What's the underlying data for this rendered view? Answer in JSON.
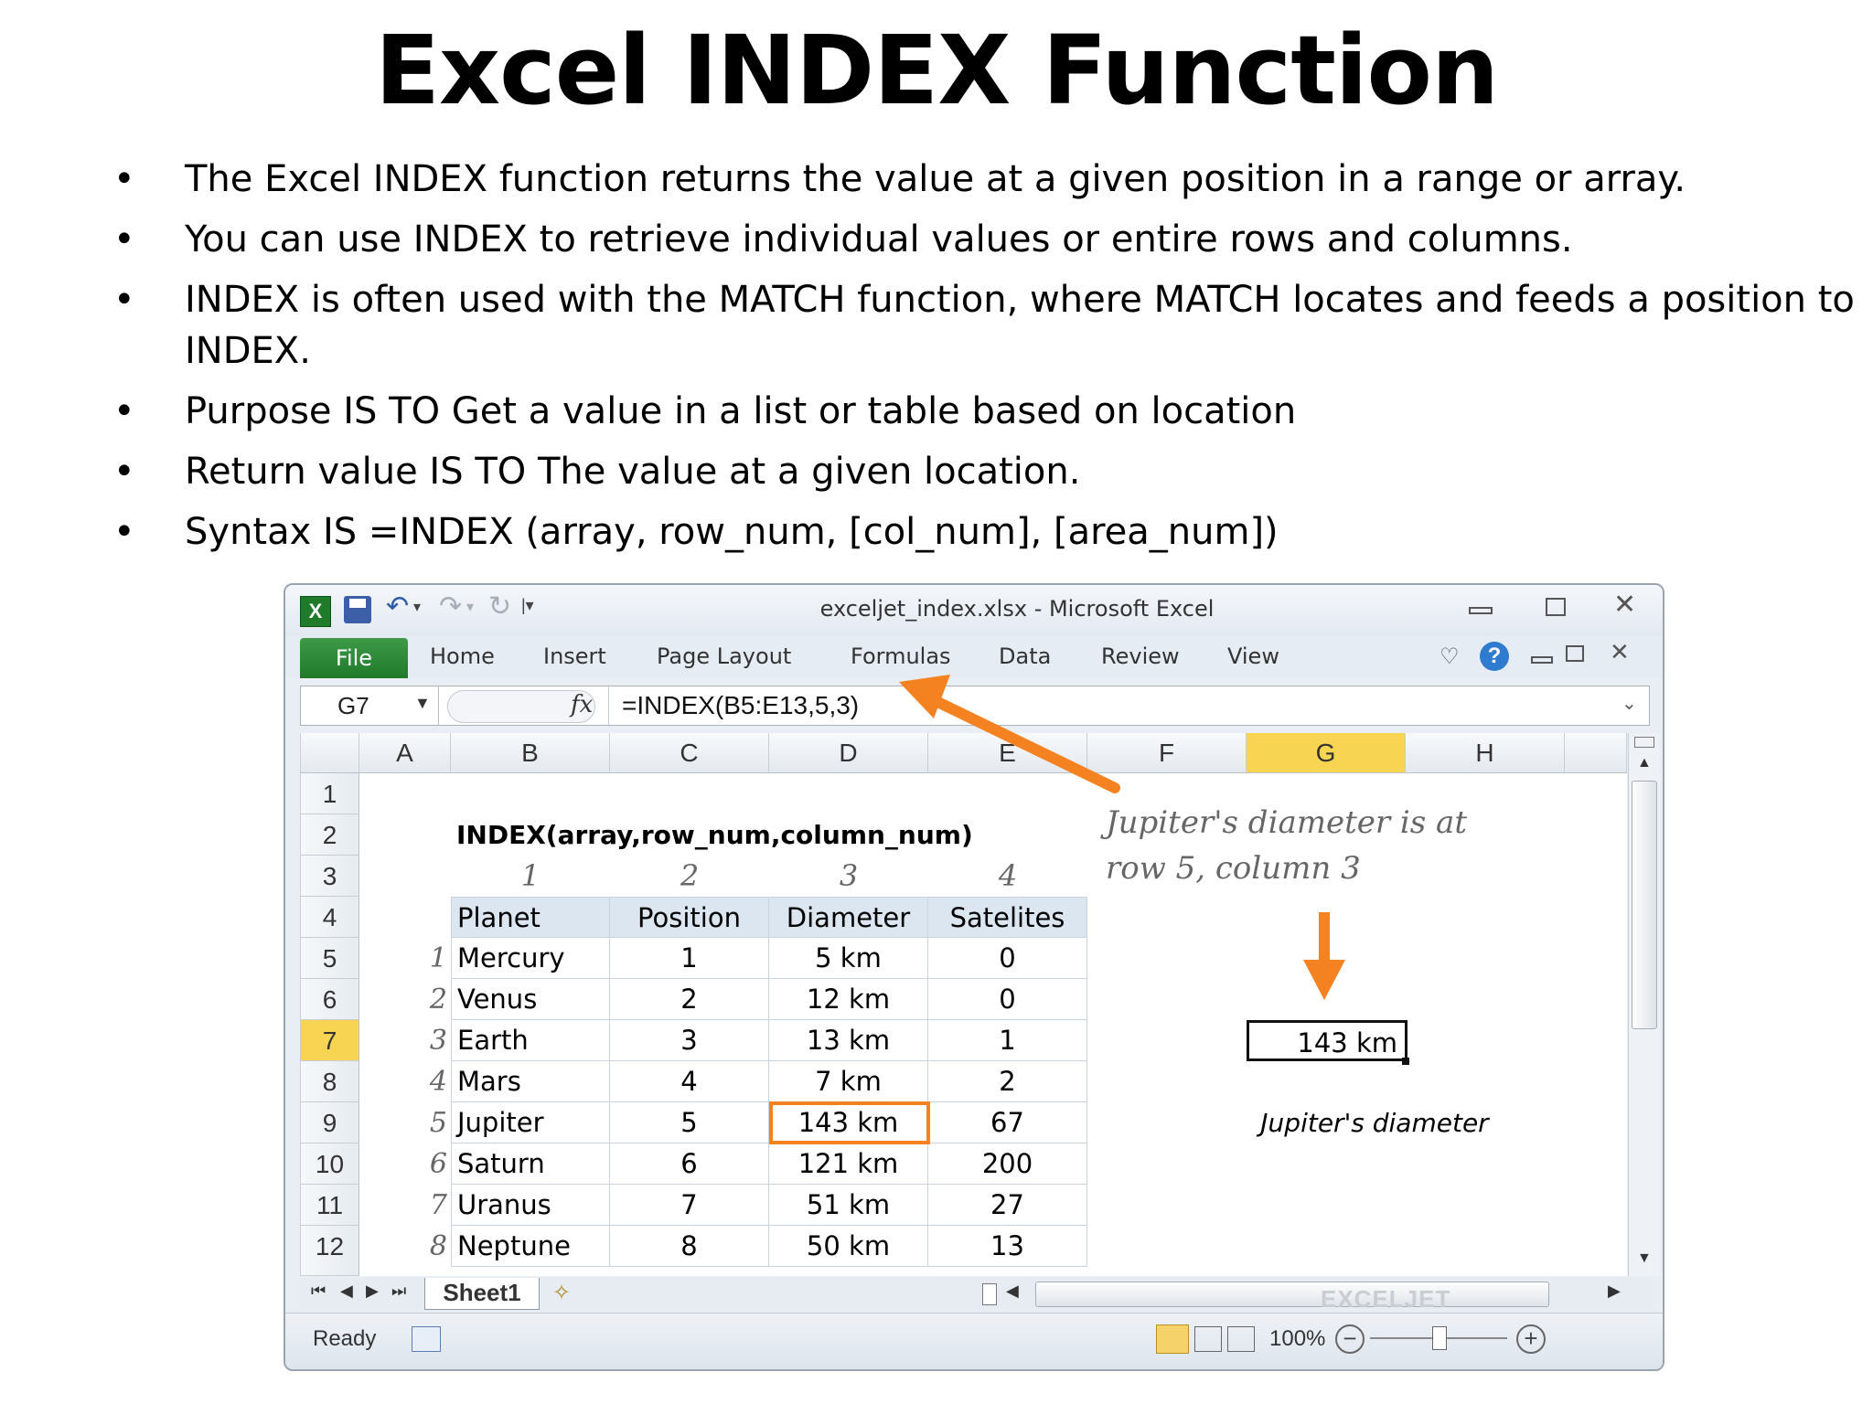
{
  "slide": {
    "title": "Excel INDEX Function",
    "bullet_symbol": "•",
    "bullets": [
      "The Excel INDEX function returns the value at a given position in a range or array.",
      "You can use INDEX to retrieve individual values or entire rows and columns.",
      "INDEX is often used with the MATCH function, where MATCH locates and feeds a position to INDEX.",
      "Purpose  IS TO Get a value in a list or table based on location",
      "Return value IS TO The value at a given location.",
      "Syntax  IS =INDEX (array, row_num, [col_num], [area_num])"
    ]
  },
  "excel": {
    "window_title": "exceljet_index.xlsx  -  Microsoft Excel",
    "ribbon_tabs": [
      "File",
      "Home",
      "Insert",
      "Page Layout",
      "Formulas",
      "Data",
      "Review",
      "View"
    ],
    "name_box": "G7",
    "fx_label": "fx",
    "formula": "=INDEX(B5:E13,5,3)",
    "column_headers": [
      "A",
      "B",
      "C",
      "D",
      "E",
      "F",
      "G",
      "H"
    ],
    "selected_column": "G",
    "row_headers": [
      "1",
      "2",
      "3",
      "4",
      "5",
      "6",
      "7",
      "8",
      "9",
      "10",
      "11",
      "12"
    ],
    "selected_row": "7",
    "syntax_label": "INDEX(array,row_num,column_num)",
    "column_index_numbers": [
      "1",
      "2",
      "3",
      "4"
    ],
    "table_headers": [
      "Planet",
      "Position",
      "Diameter",
      "Satelites"
    ],
    "table_rows": [
      {
        "idx": "1",
        "planet": "Mercury",
        "position": "1",
        "diameter": "5 km",
        "satellites": "0"
      },
      {
        "idx": "2",
        "planet": "Venus",
        "position": "2",
        "diameter": "12 km",
        "satellites": "0"
      },
      {
        "idx": "3",
        "planet": "Earth",
        "position": "3",
        "diameter": "13 km",
        "satellites": "1"
      },
      {
        "idx": "4",
        "planet": "Mars",
        "position": "4",
        "diameter": "7 km",
        "satellites": "2"
      },
      {
        "idx": "5",
        "planet": "Jupiter",
        "position": "5",
        "diameter": "143 km",
        "satellites": "67"
      },
      {
        "idx": "6",
        "planet": "Saturn",
        "position": "6",
        "diameter": "121 km",
        "satellites": "200"
      },
      {
        "idx": "7",
        "planet": "Uranus",
        "position": "7",
        "diameter": "51 km",
        "satellites": "27"
      },
      {
        "idx": "8",
        "planet": "Neptune",
        "position": "8",
        "diameter": "50 km",
        "satellites": "13"
      }
    ],
    "annotation_line1": "Jupiter's diameter is at",
    "annotation_line2": "row 5, column 3",
    "result_value": "143 km",
    "result_caption": "Jupiter's diameter",
    "sheet_tab": "Sheet1",
    "status_text": "Ready",
    "zoom": "100%",
    "watermark": "EXCELJET",
    "colors": {
      "file_tab": "#2a8a36",
      "selection_header": "#f7d552",
      "highlight_border": "#f58220",
      "arrow": "#f58220",
      "table_header_bg": "#dce6f1"
    }
  }
}
